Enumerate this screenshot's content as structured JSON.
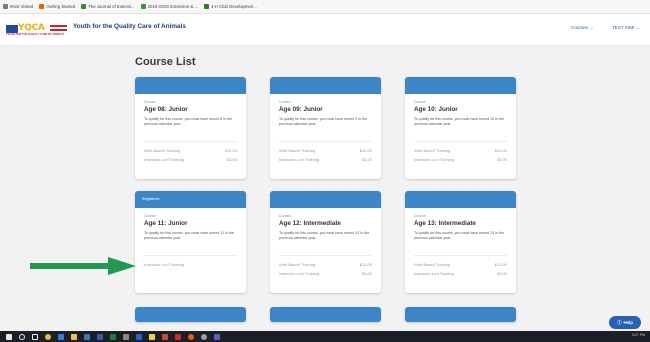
{
  "browser": {
    "bookmarks": [
      {
        "label": "Most Visited",
        "icon": "gear-icon",
        "color": "#7a7a7a"
      },
      {
        "label": "Getting Started",
        "icon": "firefox-icon",
        "color": "#e66000"
      },
      {
        "label": "The Journal of Extensi...",
        "icon": "checkmark-icon",
        "color": "#2f8a3a"
      },
      {
        "label": "2018 IOSG Extension & ...",
        "icon": "leaf-icon",
        "color": "#3f8d3f"
      },
      {
        "label": "4-H Club Developmen...",
        "icon": "clover-icon",
        "color": "#2b7a2b"
      }
    ]
  },
  "header": {
    "logo_text": "YQCA",
    "logo_tagline": "YOUTH FOR THE QUALITY CARE OF ANIMALS",
    "site_title": "Youth for the Quality Care of Animals",
    "nav_courses": "Courses",
    "nav_user": "TEST KIMI"
  },
  "main": {
    "title": "Course List"
  },
  "courses": [
    {
      "registered": "",
      "label": "Course",
      "name": "Age 08: Junior",
      "desc": "To qualify for this course, you must have turned 8 in the previous calendar year.",
      "rows": [
        {
          "type": "Web-Based Training",
          "price": "$12.00"
        },
        {
          "type": "Instructor-Led Training",
          "price": "$3.00"
        }
      ]
    },
    {
      "registered": "",
      "label": "Course",
      "name": "Age 09: Junior",
      "desc": "To qualify for this course, you must have turned 9 in the previous calendar year.",
      "rows": [
        {
          "type": "Web-Based Training",
          "price": "$12.00"
        },
        {
          "type": "Instructor-Led Training",
          "price": "$3.00"
        }
      ]
    },
    {
      "registered": "",
      "label": "Course",
      "name": "Age 10: Junior",
      "desc": "To qualify for this course, you must have turned 10 in the previous calendar year.",
      "rows": [
        {
          "type": "Web-Based Training",
          "price": "$12.00"
        },
        {
          "type": "Instructor-Led Training",
          "price": "$3.00"
        }
      ]
    },
    {
      "registered": "Registered",
      "label": "Course",
      "name": "Age 11: Junior",
      "desc": "To qualify for this course, you must have turned 11 in the previous calendar year.",
      "rows": [
        {
          "type": "Instructor-Led Training",
          "price": ""
        }
      ]
    },
    {
      "registered": "",
      "label": "Course",
      "name": "Age 12: Intermediate",
      "desc": "To qualify for this course, you must have turned 12 in the previous calendar year.",
      "rows": [
        {
          "type": "Web-Based Training",
          "price": "$12.00"
        },
        {
          "type": "Instructor-Led Training",
          "price": "$3.00"
        }
      ]
    },
    {
      "registered": "",
      "label": "Course",
      "name": "Age 13: Intermediate",
      "desc": "To qualify for this course, you must have turned 13 in the previous calendar year.",
      "rows": [
        {
          "type": "Web-Based Training",
          "price": "$12.00"
        },
        {
          "type": "Instructor-Led Training",
          "price": "$3.00"
        }
      ]
    }
  ],
  "help_label": "Help",
  "arrow_color": "#1f9a4e",
  "accent_color": "#3a86c8",
  "taskbar": {
    "clock": "3:27 PM",
    "apps": [
      {
        "icon": "windows-icon",
        "color": "#e9e9e9"
      },
      {
        "icon": "search-icon",
        "color": "#e9e9e9"
      },
      {
        "icon": "task-view-icon",
        "color": "#e9e9e9"
      },
      {
        "icon": "chrome-icon",
        "color": "#e9c137"
      },
      {
        "icon": "edge-icon",
        "color": "#2f7fd1"
      },
      {
        "icon": "file-explorer-icon",
        "color": "#f2c14e"
      },
      {
        "icon": "store-icon",
        "color": "#3a78c3"
      },
      {
        "icon": "word-icon",
        "color": "#2b5caa"
      },
      {
        "icon": "excel-icon",
        "color": "#1f7a45"
      },
      {
        "icon": "calculator-icon",
        "color": "#8a8a8a"
      },
      {
        "icon": "outlook-icon",
        "color": "#1b6ac9"
      },
      {
        "icon": "sticky-notes-icon",
        "color": "#f3d33b"
      },
      {
        "icon": "powerpoint-icon",
        "color": "#d2492a"
      },
      {
        "icon": "acrobat-icon",
        "color": "#c9302c"
      },
      {
        "icon": "firefox-icon",
        "color": "#e66000"
      },
      {
        "icon": "settings-icon",
        "color": "#9aa0a6"
      },
      {
        "icon": "teams-icon",
        "color": "#5b5fc7"
      }
    ]
  }
}
